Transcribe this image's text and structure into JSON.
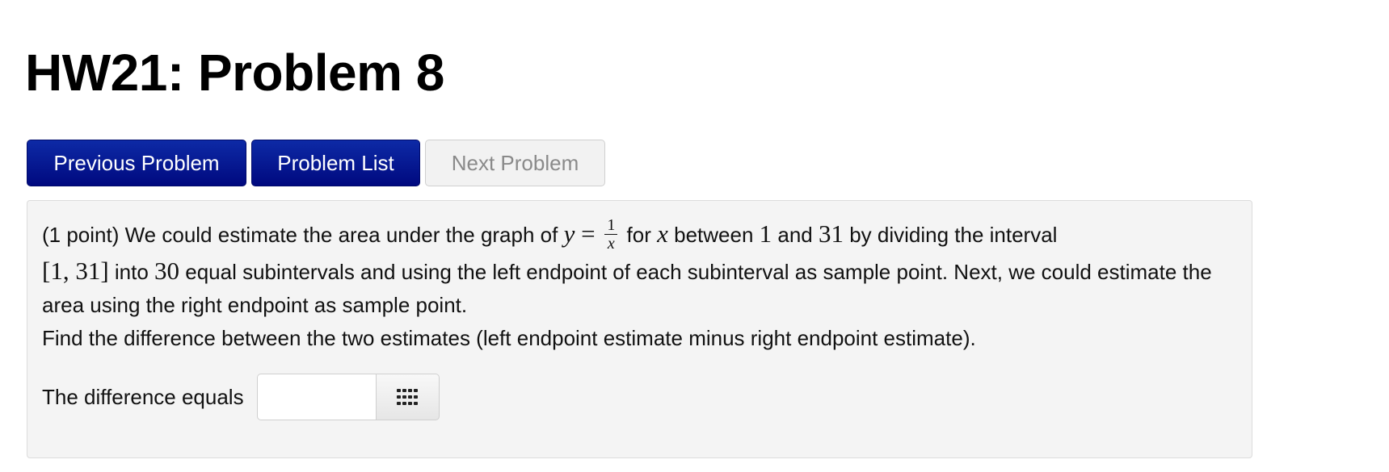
{
  "page": {
    "title": "HW21: Problem 8"
  },
  "nav": {
    "previous_label": "Previous Problem",
    "list_label": "Problem List",
    "next_label": "Next Problem"
  },
  "problem": {
    "part_1a": "(1 point) We could estimate the area under the graph of ",
    "math_y": "y",
    "math_eq": " = ",
    "frac_num": "1",
    "frac_den": "x",
    "part_1b": " for ",
    "math_x": "x",
    "part_1c": " between ",
    "math_lo": "1",
    "part_1d": " and ",
    "math_hi": "31",
    "part_1e": " by dividing the interval",
    "math_interval": "[1, 31]",
    "part_2a": " into ",
    "math_n": "30",
    "part_2b": " equal subintervals and using the left endpoint of each subinterval as sample point. Next, we could estimate the area using the right endpoint as sample point.",
    "line_3": "Find the difference between the two estimates (left endpoint estimate minus right endpoint estimate)."
  },
  "answer": {
    "label": "The difference equals",
    "value": "",
    "placeholder": "",
    "keypad_icon": "keypad-grid-icon"
  },
  "colors": {
    "primary_button": "#00097f",
    "disabled_button": "#f2f2f2",
    "problem_background": "#f4f4f4"
  }
}
